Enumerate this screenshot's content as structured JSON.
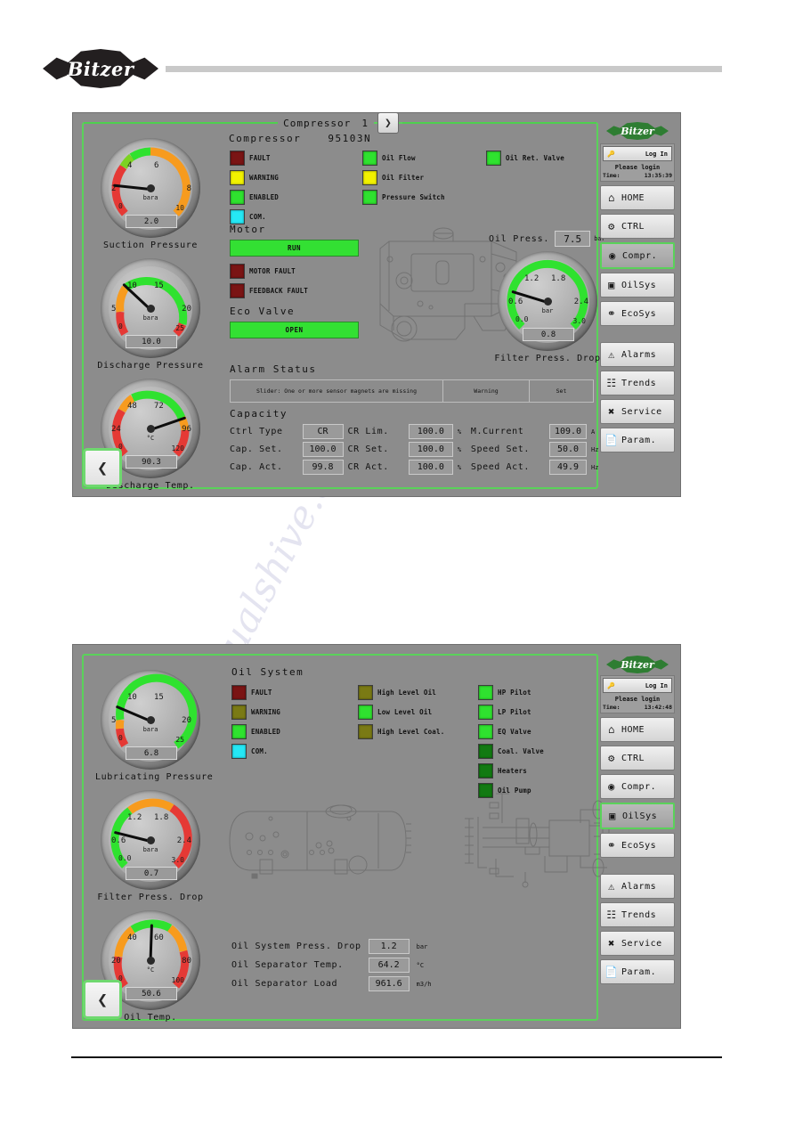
{
  "brand": {
    "name": "Bitzer"
  },
  "panel1": {
    "header": {
      "title": "Compressor",
      "number": "1",
      "next_icon": "chevron-right-icon"
    },
    "machine": {
      "label": "Compressor",
      "model": "95103N"
    },
    "gauges": [
      {
        "name": "Suction Pressure",
        "value": "2.0",
        "unit": "bara",
        "min": "0",
        "max": "10",
        "t1": "4",
        "t2": "6",
        "t3": "2",
        "t4": "8",
        "pct": 0.2
      },
      {
        "name": "Discharge Pressure",
        "value": "10.0",
        "unit": "bara",
        "min": "0",
        "max": "25",
        "t1": "10",
        "t2": "15",
        "t3": "5",
        "t4": "20",
        "pct": 0.4
      },
      {
        "name": "Discharge Temp.",
        "value": "90.3",
        "unit": "°C",
        "min": "0",
        "max": "120",
        "t1": "48",
        "t2": "72",
        "t3": "24",
        "t4": "96",
        "pct": 0.752
      }
    ],
    "status_left": [
      {
        "label": "FAULT",
        "color": "#7a1414"
      },
      {
        "label": "WARNING",
        "color": "#f2f200"
      },
      {
        "label": "ENABLED",
        "color": "#2fe22f"
      },
      {
        "label": "COM.",
        "color": "#25e8f5"
      }
    ],
    "status_mid": [
      {
        "label": "Oil Flow",
        "color": "#2fe22f"
      },
      {
        "label": "Oil Filter",
        "color": "#f2f200"
      },
      {
        "label": "Pressure Switch",
        "color": "#2fe22f"
      }
    ],
    "status_right": [
      {
        "label": "Oil Ret. Valve",
        "color": "#2fe22f"
      }
    ],
    "motor": {
      "title": "Motor",
      "run_label": "RUN",
      "lamps": [
        {
          "label": "MOTOR FAULT",
          "color": "#7a1414"
        },
        {
          "label": "FEEDBACK FAULT",
          "color": "#7a1414"
        }
      ]
    },
    "eco_valve": {
      "title": "Eco Valve",
      "state_label": "OPEN"
    },
    "alarm": {
      "title": "Alarm Status",
      "message": "Slider: One or more sensor magnets are missing",
      "severity": "Warning",
      "action": "Set"
    },
    "oil_press": {
      "label": "Oil Press.",
      "value": "7.5",
      "unit": "bar"
    },
    "filter_gauge": {
      "name": "Filter Press. Drop",
      "value": "0.8",
      "unit": "bar",
      "min": "0.0",
      "max": "3.0",
      "t1": "1.2",
      "t2": "1.8",
      "t3": "0.6",
      "t4": "2.4",
      "pct": 0.267
    },
    "capacity": {
      "title": "Capacity",
      "rows": [
        {
          "l1": "Ctrl Type",
          "v1": "CR",
          "u1": "",
          "l2": "CR Lim.",
          "v2": "100.0",
          "u2": "%",
          "l3": "M.Current",
          "v3": "109.0",
          "u3": "A"
        },
        {
          "l1": "Cap. Set.",
          "v1": "100.0",
          "u1": "%",
          "l2": "CR Set.",
          "v2": "100.0",
          "u2": "%",
          "l3": "Speed Set.",
          "v3": "50.0",
          "u3": "Hz"
        },
        {
          "l1": "Cap. Act.",
          "v1": "99.8",
          "u1": "%",
          "l2": "CR Act.",
          "v2": "100.0",
          "u2": "%",
          "l3": "Speed Act.",
          "v3": "49.9",
          "u3": "Hz"
        }
      ]
    },
    "sidebar": {
      "login_label": "Log In",
      "login_icon": "key-icon",
      "login_message": "Please login",
      "time_label": "Time:",
      "time_value": "13:35:39",
      "items": [
        {
          "label": "HOME",
          "icon": "home-icon",
          "active": false
        },
        {
          "label": "CTRL",
          "icon": "gears-icon",
          "active": false
        },
        {
          "label": "Compr.",
          "icon": "compressor-icon",
          "active": true
        },
        {
          "label": "OilSys",
          "icon": "oil-tank-icon",
          "active": false
        },
        {
          "label": "EcoSys",
          "icon": "eco-icon",
          "active": false
        }
      ],
      "items2": [
        {
          "label": "Alarms",
          "icon": "warning-triangle-icon",
          "active": false
        },
        {
          "label": "Trends",
          "icon": "chart-grid-icon",
          "active": false
        },
        {
          "label": "Service",
          "icon": "tools-icon",
          "active": false
        },
        {
          "label": "Param.",
          "icon": "document-icon",
          "active": false
        }
      ]
    },
    "back_icon": "chevron-left-icon"
  },
  "panel2": {
    "section": {
      "title": "Oil System"
    },
    "gauges": [
      {
        "name": "Lubricating Pressure",
        "value": "6.8",
        "unit": "bara",
        "min": "0",
        "max": "25",
        "t1": "10",
        "t2": "15",
        "t3": "5",
        "t4": "20",
        "pct": 0.272
      },
      {
        "name": "Filter Press. Drop",
        "value": "0.7",
        "unit": "bara",
        "min": "0.0",
        "max": "3.0",
        "t1": "1.2",
        "t2": "1.8",
        "t3": "0.6",
        "t4": "2.4",
        "pct": 0.233
      },
      {
        "name": "Oil Temp.",
        "value": "50.6",
        "unit": "°C",
        "min": "0",
        "max": "100",
        "t1": "40",
        "t2": "60",
        "t3": "20",
        "t4": "80",
        "pct": 0.506
      }
    ],
    "status_left": [
      {
        "label": "FAULT",
        "color": "#7a1414"
      },
      {
        "label": "WARNING",
        "color": "#7a7a14"
      },
      {
        "label": "ENABLED",
        "color": "#2fe22f"
      },
      {
        "label": "COM.",
        "color": "#25e8f5"
      }
    ],
    "status_mid": [
      {
        "label": "High Level Oil",
        "color": "#7a7a14"
      },
      {
        "label": "Low Level Oil",
        "color": "#2fe22f"
      },
      {
        "label": "High Level Coal.",
        "color": "#7a7a14"
      }
    ],
    "status_right": [
      {
        "label": "HP Pilot",
        "color": "#2fe22f"
      },
      {
        "label": "LP Pilot",
        "color": "#2fe22f"
      },
      {
        "label": "EQ Valve",
        "color": "#2fe22f"
      },
      {
        "label": "Coal. Valve",
        "color": "#127a12"
      },
      {
        "label": "Heaters",
        "color": "#127a12"
      },
      {
        "label": "Oil Pump",
        "color": "#127a12"
      }
    ],
    "readouts": [
      {
        "label": "Oil System Press. Drop",
        "value": "1.2",
        "unit": "bar"
      },
      {
        "label": "Oil Separator Temp.",
        "value": "64.2",
        "unit": "°C"
      },
      {
        "label": "Oil Separator Load",
        "value": "961.6",
        "unit": "m3/h"
      }
    ],
    "sidebar": {
      "login_label": "Log In",
      "login_icon": "key-icon",
      "login_message": "Please login",
      "time_label": "Time:",
      "time_value": "13:42:48",
      "items": [
        {
          "label": "HOME",
          "icon": "home-icon",
          "active": false
        },
        {
          "label": "CTRL",
          "icon": "gears-icon",
          "active": false
        },
        {
          "label": "Compr.",
          "icon": "compressor-icon",
          "active": false
        },
        {
          "label": "OilSys",
          "icon": "oil-tank-icon",
          "active": true
        },
        {
          "label": "EcoSys",
          "icon": "eco-icon",
          "active": false
        }
      ],
      "items2": [
        {
          "label": "Alarms",
          "icon": "warning-triangle-icon",
          "active": false
        },
        {
          "label": "Trends",
          "icon": "chart-grid-icon",
          "active": false
        },
        {
          "label": "Service",
          "icon": "tools-icon",
          "active": false
        },
        {
          "label": "Param.",
          "icon": "document-icon",
          "active": false
        }
      ]
    },
    "back_icon": "chevron-left-icon"
  },
  "watermark": {
    "text": "manualshive.com"
  }
}
